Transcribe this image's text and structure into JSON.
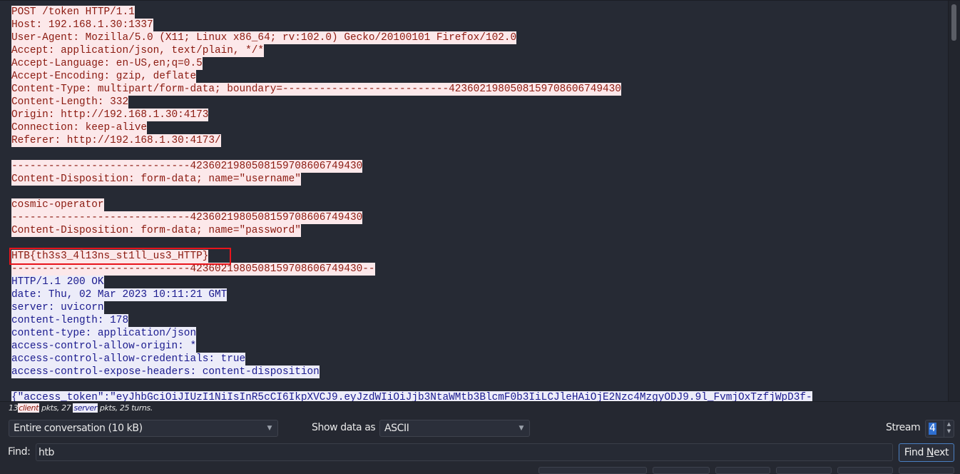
{
  "stream": {
    "client_request": [
      "POST /token HTTP/1.1",
      "Host: 192.168.1.30:1337",
      "User-Agent: Mozilla/5.0 (X11; Linux x86_64; rv:102.0) Gecko/20100101 Firefox/102.0",
      "Accept: application/json, text/plain, */*",
      "Accept-Language: en-US,en;q=0.5",
      "Accept-Encoding: gzip, deflate",
      "Content-Type: multipart/form-data; boundary=---------------------------42360219805081597086067 49430",
      "Content-Length: 332",
      "Origin: http://192.168.1.30:4173",
      "Connection: keep-alive",
      "Referer: http://192.168.1.30:4173/"
    ],
    "client_body": [
      "-----------------------------42360219805081597086067 49430",
      "Content-Disposition: form-data; name=\"username\"",
      "",
      "cosmic-operator",
      "-----------------------------42360219805081597086067 49430",
      "Content-Disposition: form-data; name=\"password\"",
      "",
      "HTB{th3s3_4l13ns_st1ll_us3_HTTP}",
      "-----------------------------42360219805081597086067 49430--"
    ],
    "server_response": [
      "HTTP/1.1 200 OK",
      "date: Thu, 02 Mar 2023 10:11:21 GMT",
      "server: uvicorn",
      "content-length: 178",
      "content-type: application/json",
      "access-control-allow-origin: *",
      "access-control-allow-credentials: true",
      "access-control-expose-headers: content-disposition"
    ],
    "server_body": [
      "{\"access_token\":\"eyJhbGciOiJIUzI1NiIsInR5cCI6IkpXVCJ9.eyJzdWIiOiJjb3NtaWMtb3BlcmF0b3IiLCJleHAiOjE2Nzc4MzgyODJ9.9l_FvmjOxTzfjWpD3f-"
    ],
    "highlighted_flag": "HTB{th3s3_4l13ns_st1ll_us3_HTTP}"
  },
  "summary": {
    "client_count": "13",
    "client_label": "client",
    "mid1": " pkts, 27 ",
    "server_label": "server",
    "tail": " pkts, 25 turns."
  },
  "controls": {
    "conversation_select": "Entire conversation (10 kB)",
    "show_data_as_label": "Show data as",
    "show_data_as_value": "ASCII",
    "stream_label": "Stream",
    "stream_value": "4",
    "find_label": "Find:",
    "find_value": "htb",
    "find_next_pre": "Find ",
    "find_next_u": "N",
    "find_next_post": "ext"
  },
  "colors": {
    "client_bg": "#fce8ea",
    "client_fg": "#8b1a10",
    "server_bg": "#ececf9",
    "server_fg": "#1a1a8e",
    "highlight_box": "#e8141c"
  }
}
